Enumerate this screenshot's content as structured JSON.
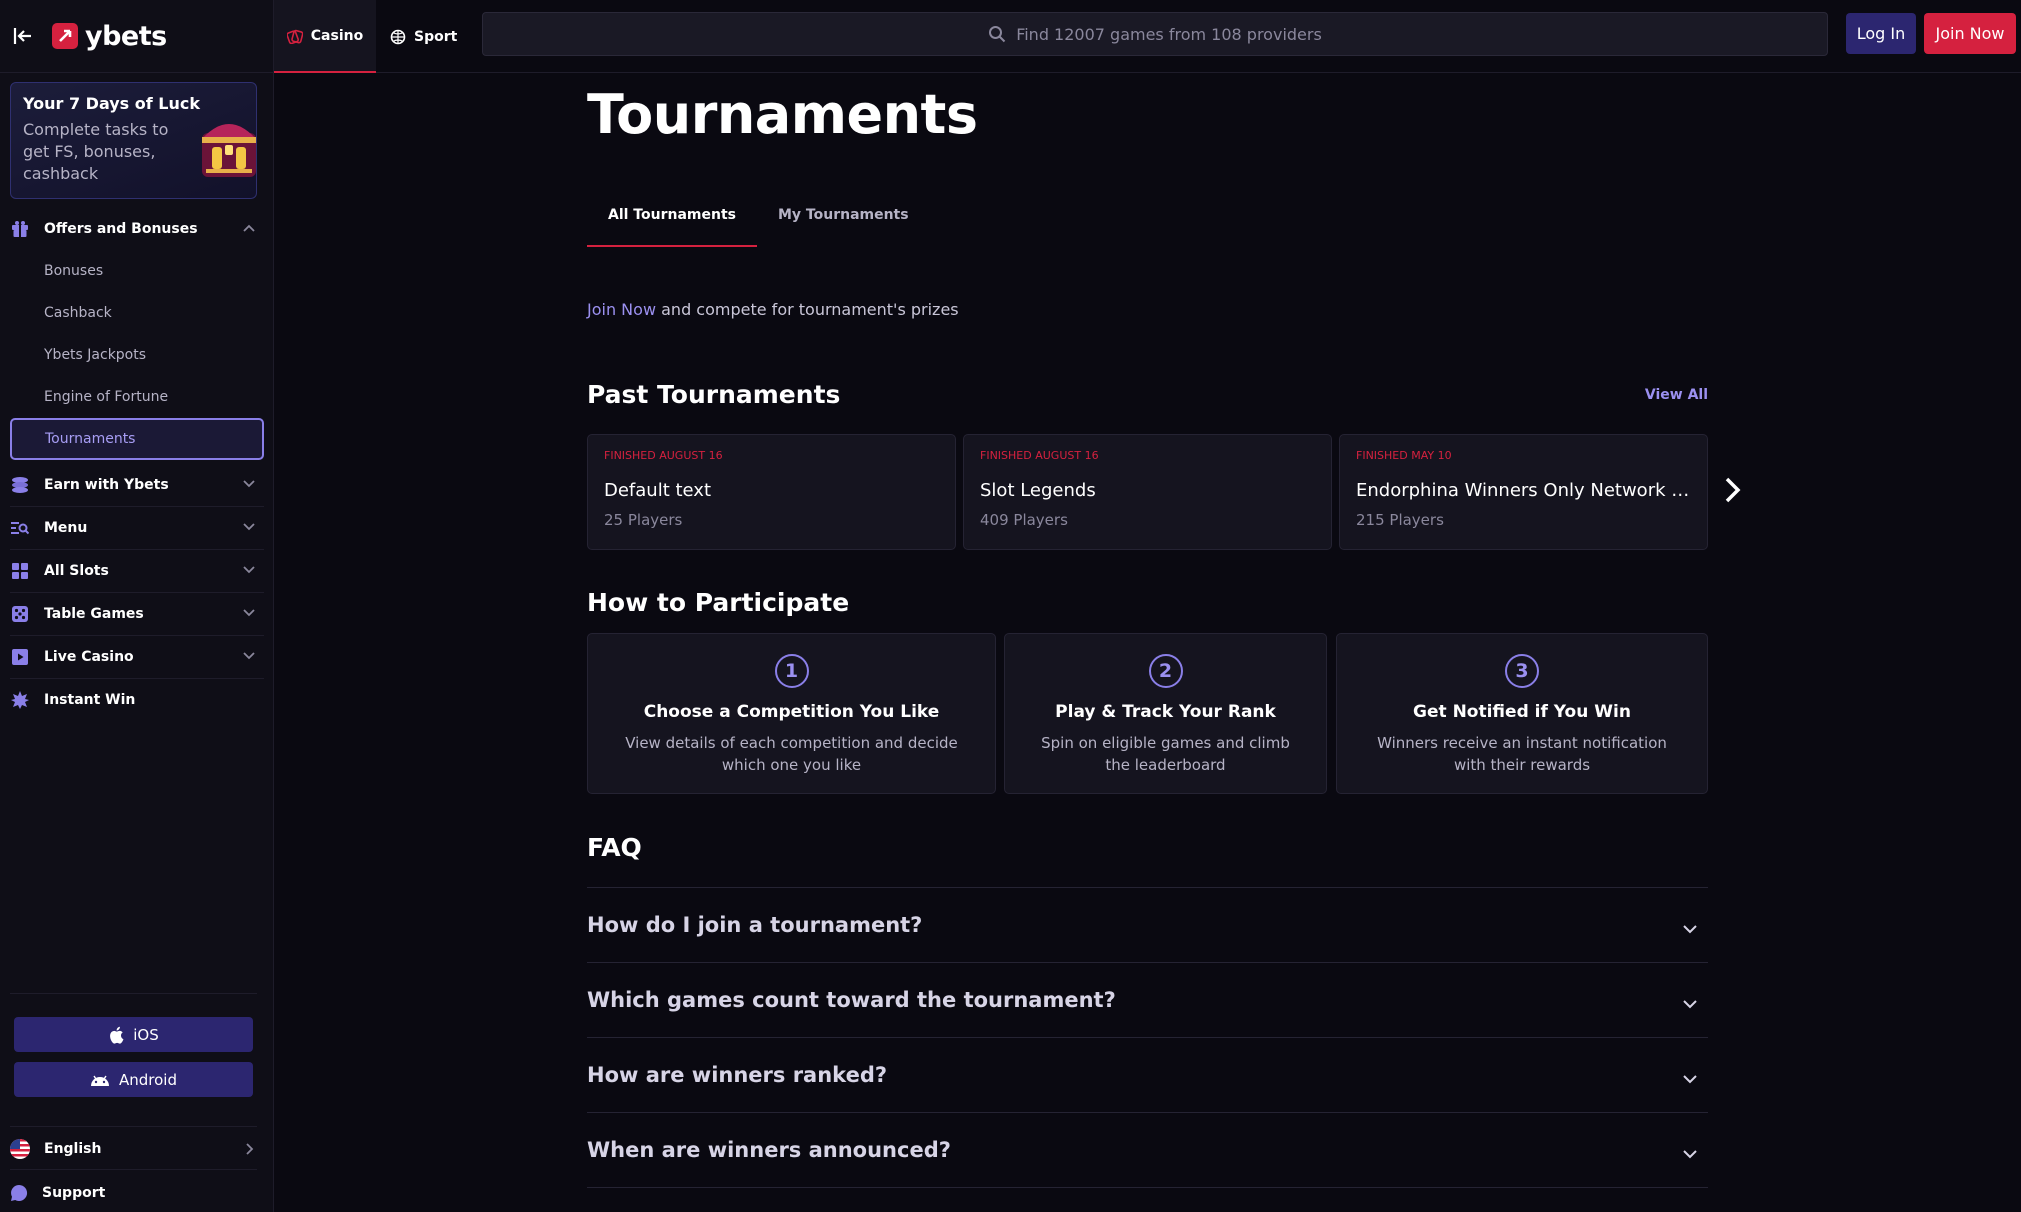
{
  "brand": {
    "name": "ybets",
    "accent": "#d5213f",
    "primary": "#2c2670",
    "link": "#9b90f0"
  },
  "topbar": {
    "tabs": [
      {
        "label": "Casino",
        "icon": "casino-icon",
        "active": true
      },
      {
        "label": "Sport",
        "icon": "ball-icon",
        "active": false
      }
    ],
    "search_placeholder": "Find 12007 games from 108 providers",
    "login_label": "Log In",
    "join_label": "Join Now"
  },
  "sidebar": {
    "promo": {
      "title": "Your 7 Days of Luck",
      "description": "Complete tasks to get FS, bonuses, cashback"
    },
    "offers": {
      "label": "Offers and Bonuses",
      "expanded": true,
      "items": [
        {
          "label": "Bonuses"
        },
        {
          "label": "Cashback"
        },
        {
          "label": "Ybets Jackpots"
        },
        {
          "label": "Engine of Fortune"
        },
        {
          "label": "Tournaments",
          "active": true
        }
      ]
    },
    "groups": [
      {
        "label": "Earn with Ybets",
        "icon": "coins-icon"
      },
      {
        "label": "Menu",
        "icon": "menu-search-icon"
      },
      {
        "label": "All Slots",
        "icon": "grid-icon"
      },
      {
        "label": "Table Games",
        "icon": "dice-icon"
      },
      {
        "label": "Live Casino",
        "icon": "play-icon"
      },
      {
        "label": "Instant Win",
        "icon": "starburst-icon"
      }
    ],
    "apps": {
      "ios": "iOS",
      "android": "Android"
    },
    "language": "English",
    "support": "Support"
  },
  "main": {
    "title": "Tournaments",
    "tabs": [
      {
        "label": "All Tournaments",
        "active": true
      },
      {
        "label": "My Tournaments",
        "active": false
      }
    ],
    "join_link": "Join Now",
    "join_text": " and compete for tournament's prizes",
    "past": {
      "title": "Past Tournaments",
      "view_all": "View All",
      "cards": [
        {
          "status": "Finished August 16",
          "name": "Default text",
          "players": "25 Players"
        },
        {
          "status": "Finished August 16",
          "name": "Slot Legends",
          "players": "409 Players"
        },
        {
          "status": "Finished May 10",
          "name": "Endorphina Winners Only Network T...",
          "players": "215 Players"
        }
      ]
    },
    "how": {
      "title": "How to Participate",
      "steps": [
        {
          "num": "1",
          "title": "Choose a Competition You Like",
          "desc": "View details of each competition and decide which one you like"
        },
        {
          "num": "2",
          "title": "Play & Track Your Rank",
          "desc": "Spin on eligible games and climb the leaderboard"
        },
        {
          "num": "3",
          "title": "Get Notified if You Win",
          "desc": "Winners receive an instant notification with their rewards"
        }
      ]
    },
    "faq": {
      "title": "FAQ",
      "items": [
        {
          "q": "How do I join a tournament?"
        },
        {
          "q": "Which games count toward the tournament?"
        },
        {
          "q": "How are winners ranked?"
        },
        {
          "q": "When are winners announced?"
        }
      ]
    }
  }
}
